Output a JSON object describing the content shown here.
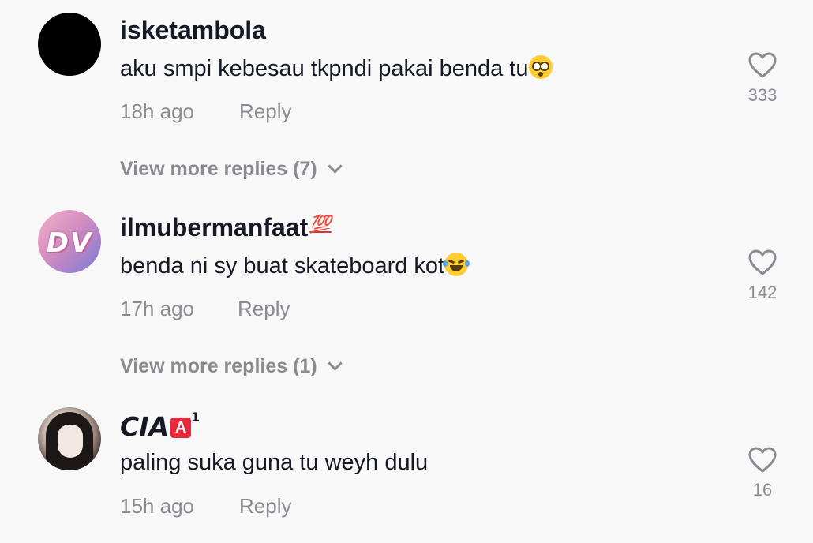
{
  "comments": [
    {
      "username": "isketambola",
      "text": "aku smpi kebesau tkpndi pakai benda tu",
      "text_emoji": "flushed-face",
      "time": "18h ago",
      "reply_label": "Reply",
      "likes": "333",
      "view_more": "View more replies (7)"
    },
    {
      "username": "ilmubermanfaat",
      "username_emoji": "💯",
      "avatar_text": "DV",
      "text": "benda ni sy buat skateboard kot",
      "text_emoji": "face-with-tears-of-joy",
      "time": "17h ago",
      "reply_label": "Reply",
      "likes": "142",
      "view_more": "View more replies (1)"
    },
    {
      "username": "CIA",
      "username_badge": "A",
      "username_sup": "1",
      "text": "paling suka guna tu weyh dulu",
      "time": "15h ago",
      "reply_label": "Reply",
      "likes": "16"
    }
  ],
  "icons": {
    "like": "heart-outline-icon",
    "expand": "chevron-down-icon"
  },
  "colors": {
    "background": "#f8f8f8",
    "primary_text": "#161823",
    "secondary_text": "#8a8b91"
  }
}
